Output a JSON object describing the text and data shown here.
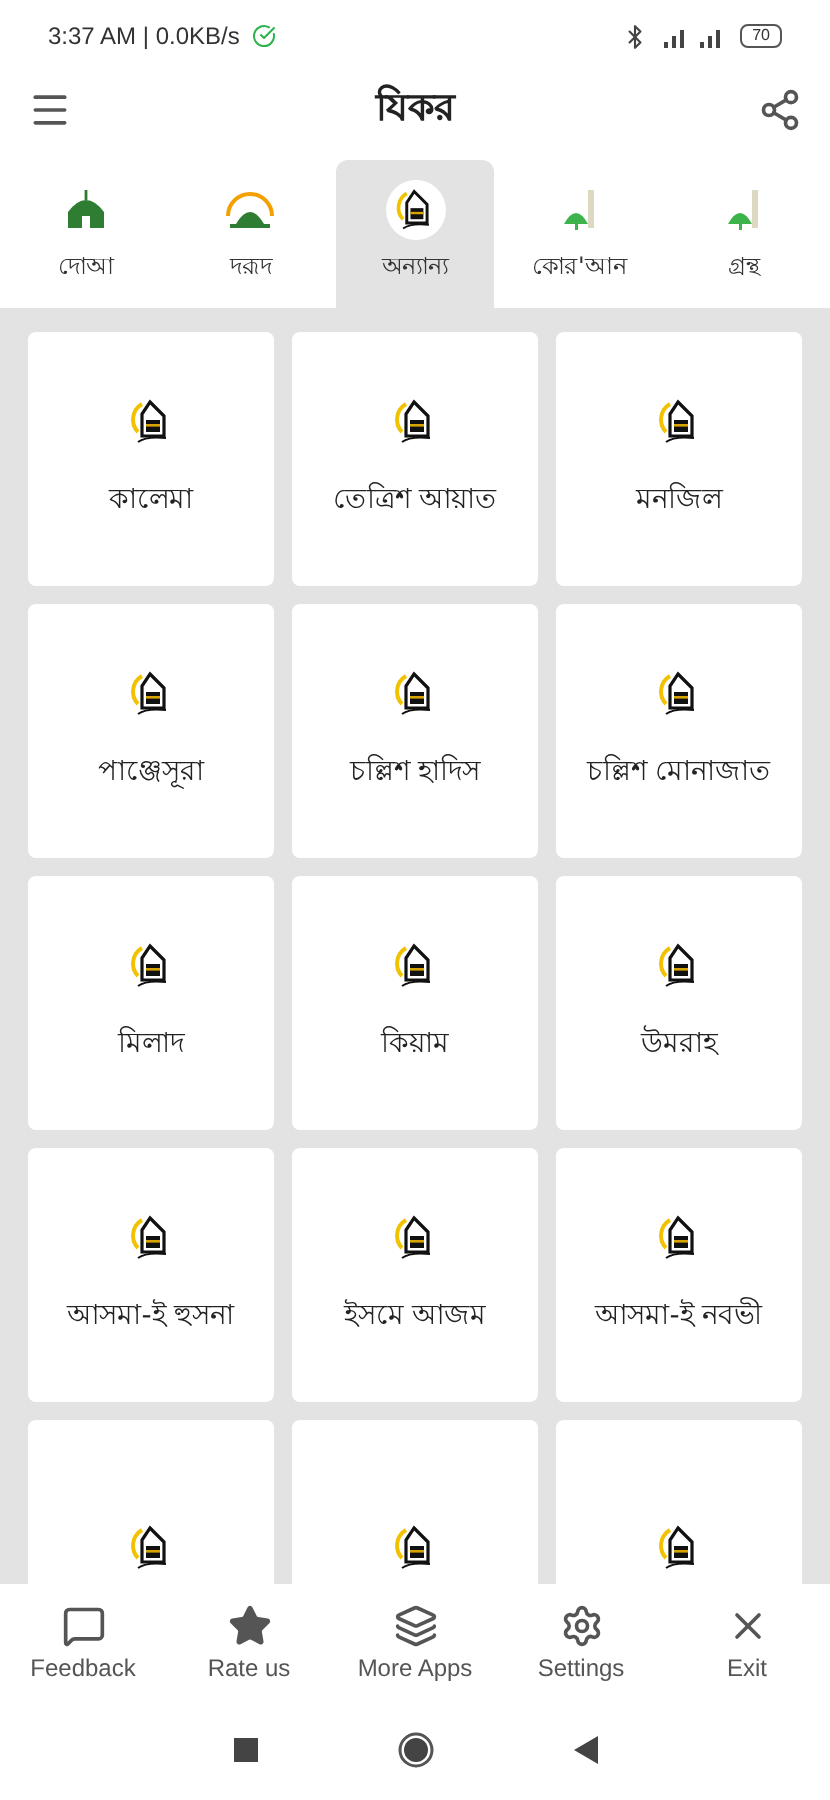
{
  "status_bar": {
    "time": "3:37 AM | 0.0KB/s",
    "battery": "70"
  },
  "app_bar": {
    "title": "যিকর"
  },
  "tabs": [
    {
      "label": "দোআ",
      "kind": "mosque",
      "selected": false
    },
    {
      "label": "দরূদ",
      "kind": "dome",
      "selected": false
    },
    {
      "label": "অন্যান্য",
      "kind": "kaaba",
      "selected": true
    },
    {
      "label": "কোর'আন",
      "kind": "minaret",
      "selected": false
    },
    {
      "label": "গ্রন্থ",
      "kind": "minaret",
      "selected": false
    }
  ],
  "cards": [
    {
      "kind": "item",
      "label": "কালেমা"
    },
    {
      "kind": "item",
      "label": "তেত্রিশ আয়াত"
    },
    {
      "kind": "item",
      "label": "মনজিল"
    },
    {
      "kind": "item",
      "label": "পাঞ্জেসূরা"
    },
    {
      "kind": "item",
      "label": "চল্লিশ হাদিস"
    },
    {
      "kind": "item",
      "label": "চল্লিশ মোনাজাত"
    },
    {
      "kind": "item",
      "label": "মিলাদ"
    },
    {
      "kind": "item",
      "label": "কিয়াম"
    },
    {
      "kind": "item",
      "label": "উমরাহ"
    },
    {
      "kind": "item",
      "label": "আসমা-ই হুসনা"
    },
    {
      "kind": "item",
      "label": "ইসমে আজম"
    },
    {
      "kind": "item",
      "label": "আসমা-ই নবভী"
    },
    {
      "kind": "cut"
    },
    {
      "kind": "cut"
    },
    {
      "kind": "cut"
    }
  ],
  "bottom_nav": [
    {
      "label": "Feedback",
      "kind": "message"
    },
    {
      "label": "Rate us",
      "kind": "star"
    },
    {
      "label": "More Apps",
      "kind": "layers"
    },
    {
      "label": "Settings",
      "kind": "gear"
    },
    {
      "label": "Exit",
      "kind": "close"
    }
  ]
}
